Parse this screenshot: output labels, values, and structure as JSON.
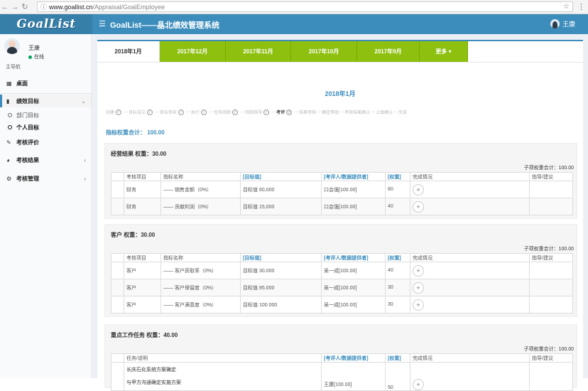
{
  "browser": {
    "url_host": "www.goallist.cn",
    "url_path": "/Appraisal/GoalEmployee"
  },
  "header": {
    "logo": "GoalList",
    "title": "GoalList——晶北绩效管理系统",
    "user": "王康"
  },
  "sidebar": {
    "user_name": "王康",
    "status": "在线",
    "nav_header": "主导航",
    "items": [
      {
        "label": "桌面"
      },
      {
        "label": "绩效目标"
      },
      {
        "label": "部门目标"
      },
      {
        "label": "个人目标"
      },
      {
        "label": "考核评价"
      },
      {
        "label": "考核结果"
      },
      {
        "label": "考核管理"
      }
    ]
  },
  "tabs": [
    "2018年1月",
    "2017年12月",
    "2017年11月",
    "2017年10月",
    "2017年9月",
    "更多 ▾"
  ],
  "period_title": "2018年1月",
  "steps": [
    "创建",
    "目标设立",
    "目标审核",
    "执行",
    "任务回顾",
    "回顾指导",
    "考评",
    "结果审核",
    "确定等级",
    "考核结果确认",
    "上级确认",
    "完成"
  ],
  "weight_total_label": "指标权重合计：",
  "weight_total_value": "100.00",
  "sections": [
    {
      "title": "经营结果  权重：30.00",
      "sub_total": "子项权重合计：100.00",
      "headers": [
        "考核项目",
        "指标名称",
        "[目标值]",
        "[考评人/数据提供者]",
        "[权重]",
        "完成情况",
        "指导/建议"
      ],
      "rows": [
        [
          "财务",
          "—— 销售金额（0%）",
          "目标值 60,000",
          "口会强[100.00]",
          "60"
        ],
        [
          "财务",
          "—— 贡献利润（0%）",
          "目标值 15,000",
          "口会强[100.00]",
          "40"
        ]
      ]
    },
    {
      "title": "客户  权重：30.00",
      "sub_total": "子项权重合计：100.00",
      "headers": [
        "考核项目",
        "指标名称",
        "[目标值]",
        "[考评人/数据提供者]",
        "[权重]",
        "完成情况",
        "指导/建议"
      ],
      "rows": [
        [
          "客户",
          "—— 客户获取率（0%）",
          "目标值 30.000",
          "吴一成[100.00]",
          "40"
        ],
        [
          "客户",
          "—— 客户保留度（0%）",
          "目标值 85.000",
          "吴一成[100.00]",
          "30"
        ],
        [
          "客户",
          "—— 客户满意度（0%）",
          "目标值 100.000",
          "吴一成[100.00]",
          "30"
        ]
      ]
    },
    {
      "title": "重点工作任务  权重：40.00",
      "sub_total": "子项权重合计：100.00",
      "headers": [
        "任务/说明",
        "[考评人/数据提供者]",
        "[权重]",
        "完成情况",
        "指导/建议"
      ],
      "rows": [
        [
          "长庆石化系统方案确定",
          "与甲方沟通确定实施方案",
          "王康[100.00]",
          "50"
        ]
      ]
    }
  ],
  "plus_symbol": "+"
}
